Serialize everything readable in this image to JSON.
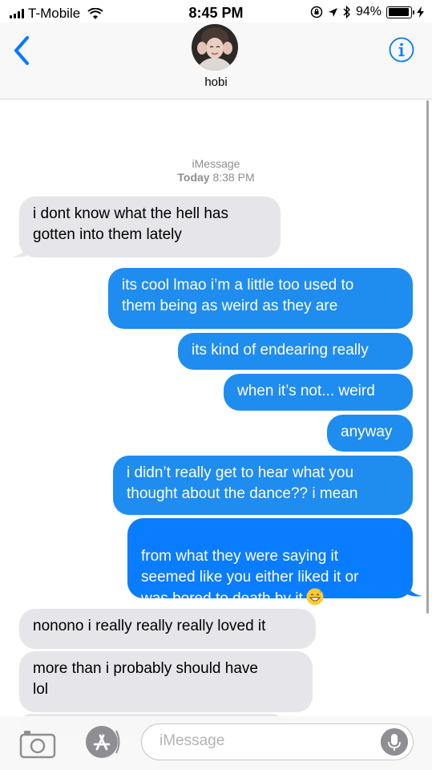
{
  "status_bar": {
    "carrier": "T-Mobile",
    "time": "8:45 PM",
    "battery_percent": "94%",
    "battery_level": 0.94
  },
  "header": {
    "back_icon": "chevron-left-icon",
    "contact_name": "hobi",
    "info_icon": "info-icon"
  },
  "conversation": {
    "service": "iMessage",
    "date_label": "Today",
    "time_label": "8:38 PM"
  },
  "messages": [
    {
      "from": "received",
      "text": "i dont know what the hell has\ngotten into them lately"
    },
    {
      "from": "sent",
      "text": "its cool lmao i’m a little too used to\nthem being as weird as they are"
    },
    {
      "from": "sent",
      "text": "its kind of endearing really"
    },
    {
      "from": "sent",
      "text": "when it’s not... weird"
    },
    {
      "from": "sent",
      "text": "anyway"
    },
    {
      "from": "sent",
      "text": "i didn’t really get to hear what you\nthought about the dance?? i mean"
    },
    {
      "from": "sent",
      "text": "from what they were saying it\nseemed like you either liked it or\nwas bored to death by it",
      "emoji": "grinning-sweat-emoji"
    },
    {
      "from": "received",
      "text": "nonono i really really really loved it"
    },
    {
      "from": "received",
      "text": "more than i probably should have\nlol"
    }
  ],
  "compose": {
    "placeholder": "iMessage",
    "camera_icon": "camera-icon",
    "apps_icon": "app-store-icon",
    "mic_icon": "microphone-icon"
  },
  "colors": {
    "sent_bubble": "#1f8cf0",
    "received_bubble": "#e5e5ea",
    "accent": "#007aff"
  }
}
